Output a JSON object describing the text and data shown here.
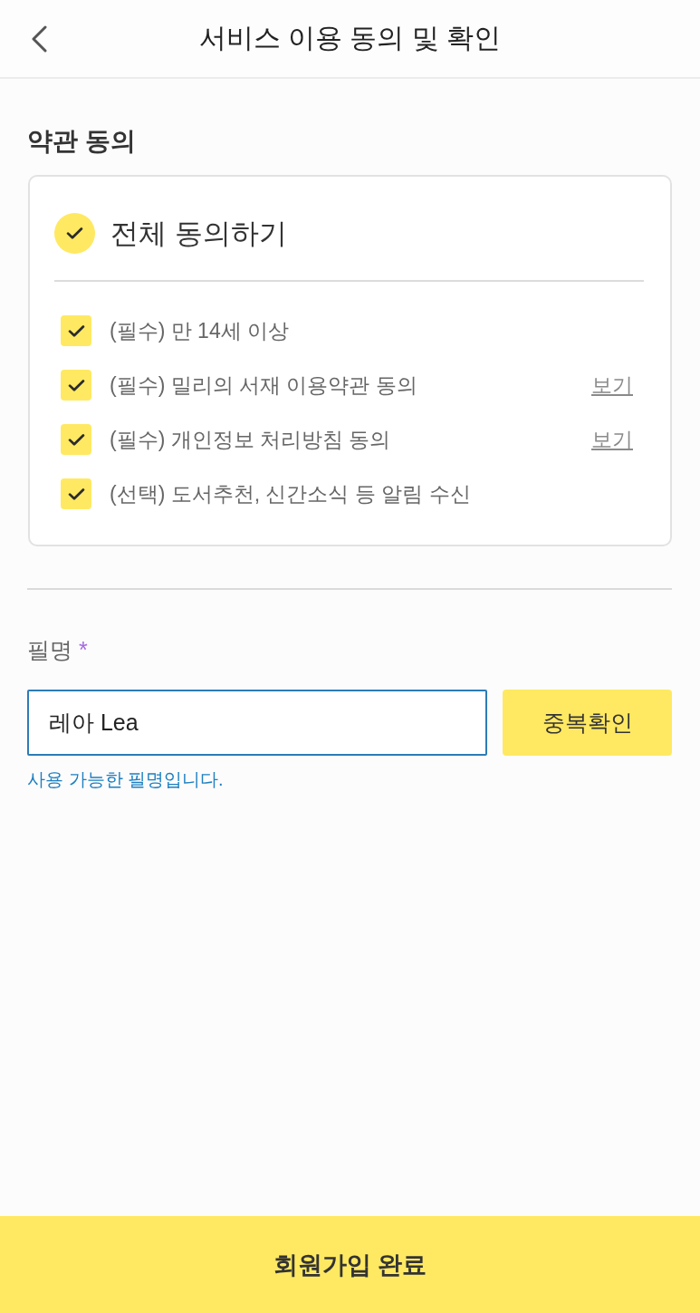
{
  "header": {
    "title": "서비스 이용 동의 및 확인"
  },
  "terms": {
    "title": "약관 동의",
    "agree_all": {
      "label": "전체 동의하기",
      "checked": true
    },
    "items": [
      {
        "label": "(필수) 만 14세 이상",
        "checked": true
      },
      {
        "label": "(필수) 밀리의 서재 이용약관 동의",
        "checked": true,
        "link": "보기"
      },
      {
        "label": "(필수) 개인정보 처리방침 동의",
        "checked": true,
        "link": "보기"
      },
      {
        "label": "(선택) 도서추천, 신간소식 등 알림 수신",
        "checked": true
      }
    ]
  },
  "nickname": {
    "label": "필명",
    "required_mark": "*",
    "value": "레아 Lea",
    "check_button": "중복확인",
    "message": "사용 가능한 필명입니다."
  },
  "submit_button": "회원가입 완료"
}
